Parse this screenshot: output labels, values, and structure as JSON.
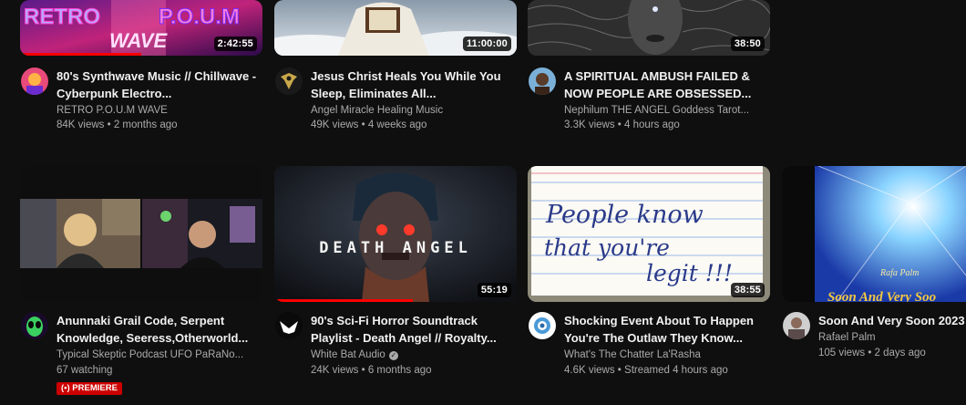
{
  "videos": [
    {
      "title": "80's Synthwave Music // Chillwave - Cyberpunk Electro...",
      "channel": "RETRO P.O.U.M WAVE",
      "stats": "84K views • 2 months ago",
      "duration": "2:42:55",
      "thumb_text_1": "RETRO",
      "thumb_text_2": "P.O.U.M",
      "thumb_text_3": "WAVE",
      "watch_progress": 0.5
    },
    {
      "title": "Jesus Christ Heals You While You Sleep, Eliminates All...",
      "channel": "Angel Miracle Healing Music",
      "stats": "49K views • 4 weeks ago",
      "duration": "11:00:00"
    },
    {
      "title": "A SPIRITUAL AMBUSH FAILED & NOW PEOPLE ARE OBSESSED...",
      "channel": "Nephilum THE ANGEL Goddess Tarot...",
      "stats": "3.3K views • 4 hours ago",
      "duration": "38:50"
    },
    {
      "title": "Anunnaki Grail Code, Serpent Knowledge, Seeress,Otherworld...",
      "channel": "Typical Skeptic Podcast UFO PaRaNo...",
      "stats": "67 watching",
      "badge": "PREMIERE"
    },
    {
      "title": "90's Sci-Fi Horror Soundtrack Playlist - Death Angel // Royalty...",
      "channel": "White Bat Audio",
      "stats": "24K views • 6 months ago",
      "duration": "55:19",
      "thumb_text_1": "DEATH",
      "thumb_text_2": "ANGEL",
      "watch_progress": 0.57,
      "verified_mark": "✓"
    },
    {
      "title": "Shocking Event About To Happen You're The Outlaw They Know...",
      "channel": "What's The Chatter La'Rasha",
      "stats": "4.6K views • Streamed 4 hours ago",
      "duration": "38:55",
      "thumb_text_1": "People know",
      "thumb_text_2": "that you're",
      "thumb_text_3": "legit !!!"
    },
    {
      "title": "Soon And Very Soon 2023",
      "channel": "Rafael Palm",
      "stats": "105 views • 2 days ago",
      "thumb_text_1": "Rafa Palm",
      "thumb_text_2": "Soon And Very Soo"
    }
  ],
  "colors": {
    "background": "#0f0f0f",
    "accent": "#ff0000",
    "secondary_text": "#aaaaaa"
  }
}
